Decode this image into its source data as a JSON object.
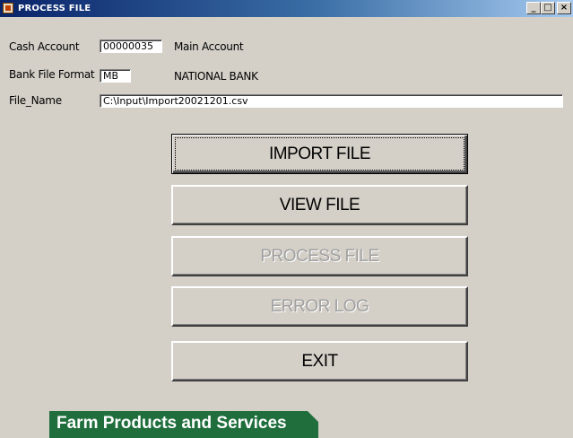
{
  "window": {
    "title": "PROCESS FILE",
    "controls": {
      "minimize": "_",
      "maximize": "□",
      "close": "×"
    }
  },
  "form": {
    "cash_account": {
      "label": "Cash Account",
      "value": "00000035",
      "description": "Main Account"
    },
    "bank_file_format": {
      "label": "Bank File Format",
      "value": "MB",
      "description": "NATIONAL BANK"
    },
    "file_name": {
      "label": "File_Name",
      "value": "C:\\Input\\Import20021201.csv"
    }
  },
  "buttons": {
    "import_file": "IMPORT FILE",
    "view_file": "VIEW FILE",
    "process_file": "PROCESS FILE",
    "error_log": "ERROR LOG",
    "exit": "EXIT"
  },
  "banner": {
    "text": "Farm Products and Services"
  },
  "colors": {
    "titlebar_start": "#0a246a",
    "titlebar_end": "#a6caf0",
    "face": "#d4d0c8",
    "banner": "#1f6e3c",
    "disabled_text": "#a0a0a0"
  }
}
